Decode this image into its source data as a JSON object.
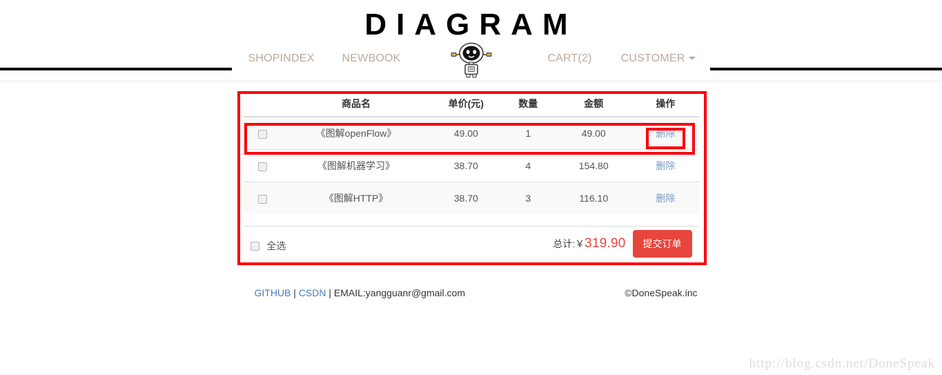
{
  "page": {
    "title": "DIAGRAM",
    "watermark": "http://blog.csdn.net/DoneSpeak"
  },
  "navbar": {
    "logo_icon": "robot-logo-icon",
    "left_links": [
      {
        "label": "SHOPINDEX",
        "name": "nav-shopindex"
      },
      {
        "label": "NEWBOOK",
        "name": "nav-newbook"
      }
    ],
    "right_links": [
      {
        "label": "CART(2)",
        "name": "nav-cart"
      },
      {
        "label": "CUSTOMER",
        "name": "nav-customer",
        "has_caret": true
      }
    ]
  },
  "cart": {
    "columns": [
      "",
      "商品名",
      "单价(元)",
      "数量",
      "金额",
      "操作"
    ],
    "rows": [
      {
        "checked": false,
        "name": "《图解openFlow》",
        "price": "49.00",
        "qty": "1",
        "amount": "49.00",
        "action": "删除"
      },
      {
        "checked": false,
        "name": "《图解机器学习》",
        "price": "38.70",
        "qty": "4",
        "amount": "154.80",
        "action": "删除"
      },
      {
        "checked": false,
        "name": "《图解HTTP》",
        "price": "38.70",
        "qty": "3",
        "amount": "116.10",
        "action": "删除"
      }
    ],
    "select_all_label": "全选",
    "select_all_checked": false,
    "total_label": "总计:￥",
    "total_amount": "319.90",
    "submit_label": "提交订单"
  },
  "footer": {
    "github_label": "GITHUB",
    "sep1": " | ",
    "csdn_label": "CSDN",
    "sep2": " | ",
    "email_text": "EMAIL:yangguanr@gmail.com",
    "copyright": "©DoneSpeak.inc"
  },
  "colors": {
    "annotation_red": "#fb0007",
    "brand_red": "#e8453c",
    "nav_link": "#bdaa9a",
    "link_blue": "#4a7ebb",
    "delete_link": "#7a9cc6"
  }
}
